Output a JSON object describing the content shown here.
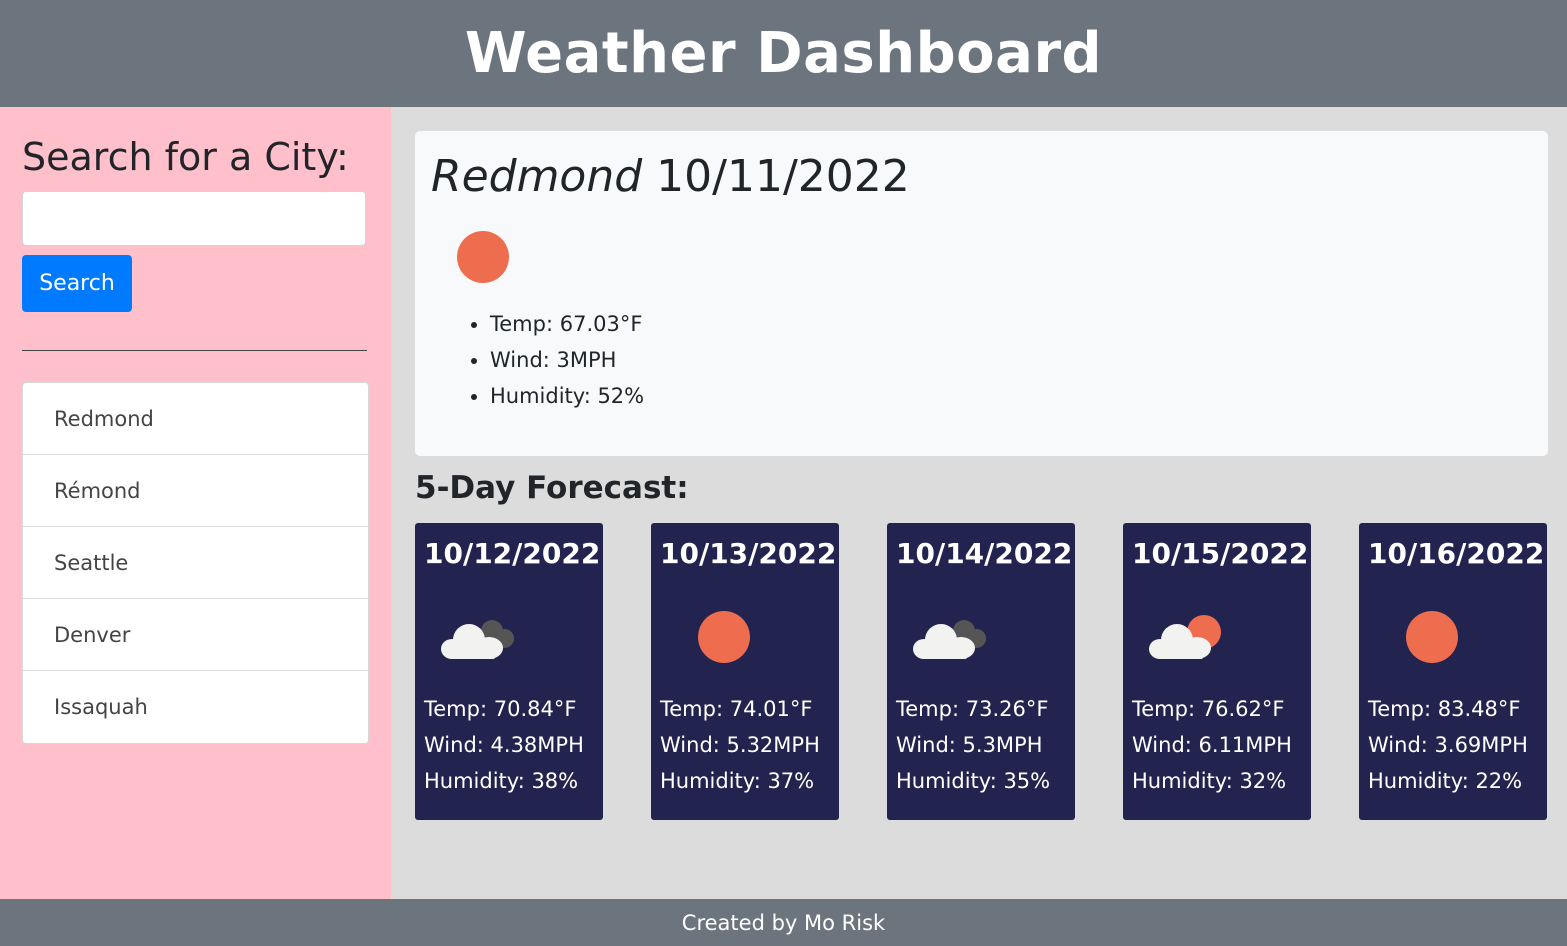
{
  "header": {
    "title": "Weather Dashboard"
  },
  "sidebar": {
    "heading": "Search for a City:",
    "search_value": "",
    "search_button": "Search",
    "history": [
      "Redmond",
      "Rémond",
      "Seattle",
      "Denver",
      "Issaquah"
    ]
  },
  "current": {
    "city": "Redmond",
    "date": "10/11/2022",
    "icon": "sun-icon",
    "temp": "Temp: 67.03°F",
    "wind": "Wind: 3MPH",
    "humidity": "Humidity: 52%"
  },
  "forecast": {
    "heading": "5-Day Forecast:",
    "days": [
      {
        "date": "10/12/2022",
        "icon": "dark-cloud-icon",
        "temp": "Temp: 70.84°F",
        "wind": "Wind: 4.38MPH",
        "humidity": "Humidity: 38%"
      },
      {
        "date": "10/13/2022",
        "icon": "sun-icon",
        "temp": "Temp: 74.01°F",
        "wind": "Wind: 5.32MPH",
        "humidity": "Humidity: 37%"
      },
      {
        "date": "10/14/2022",
        "icon": "dark-cloud-icon",
        "temp": "Temp: 73.26°F",
        "wind": "Wind: 5.3MPH",
        "humidity": "Humidity: 35%"
      },
      {
        "date": "10/15/2022",
        "icon": "sun-behind-cloud-icon",
        "temp": "Temp: 76.62°F",
        "wind": "Wind: 6.11MPH",
        "humidity": "Humidity: 32%"
      },
      {
        "date": "10/16/2022",
        "icon": "sun-icon",
        "temp": "Temp: 83.48°F",
        "wind": "Wind: 3.69MPH",
        "humidity": "Humidity: 22%"
      }
    ]
  },
  "colors": {
    "header_bg": "#6c757d",
    "sidebar_bg": "#ffc0cb",
    "main_bg": "#dcdcdc",
    "card_bg": "#232350",
    "button_bg": "#007bff",
    "sun": "#ee6d4f"
  },
  "footer": {
    "text": "Created by Mo Risk"
  }
}
